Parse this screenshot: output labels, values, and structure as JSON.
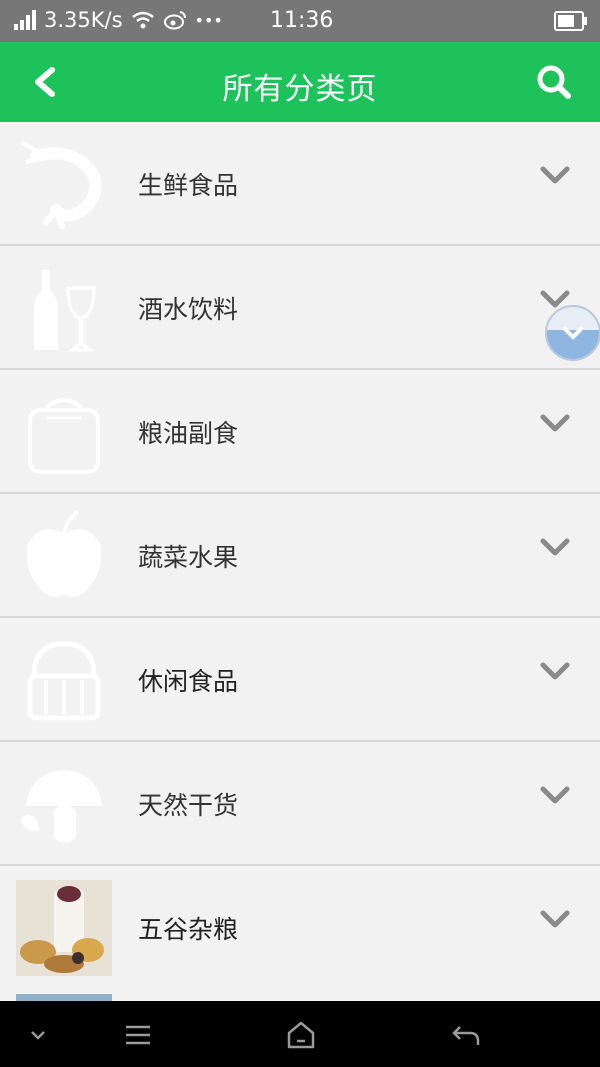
{
  "status_bar": {
    "network_speed": "3.35K/s",
    "more": "•••",
    "time": "11:36"
  },
  "header": {
    "title": "所有分类页"
  },
  "categories": [
    {
      "label": "生鲜食品",
      "icon": "shrimp-icon"
    },
    {
      "label": "酒水饮料",
      "icon": "bottle-glass-icon"
    },
    {
      "label": "粮油副食",
      "icon": "grain-sack-icon"
    },
    {
      "label": "蔬菜水果",
      "icon": "apple-icon"
    },
    {
      "label": "休闲食品",
      "icon": "basket-icon"
    },
    {
      "label": "天然干货",
      "icon": "mushroom-icon"
    },
    {
      "label": "五谷杂粮",
      "icon": "grains-photo"
    }
  ],
  "colors": {
    "accent": "#1dc35a",
    "status_bar": "#777777",
    "list_background": "#f2f2f2",
    "chevron": "#8a8a8a"
  }
}
